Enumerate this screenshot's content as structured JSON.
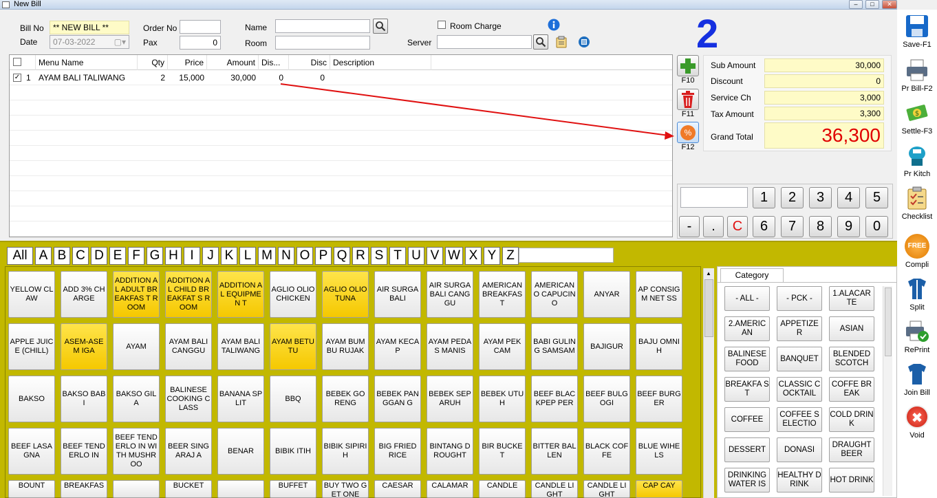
{
  "window": {
    "title": "New Bill",
    "min": "–",
    "max": "□",
    "close": "✕"
  },
  "header": {
    "bill_no_label": "Bill No",
    "bill_no": "** NEW BILL **",
    "date_label": "Date",
    "date": "07-03-2022",
    "order_no_label": "Order No",
    "order_no": "",
    "pax_label": "Pax",
    "pax": "0",
    "name_label": "Name",
    "name": "",
    "room_label": "Room",
    "room": "",
    "room_charge_label": "Room Charge",
    "server_label": "Server",
    "server": ""
  },
  "table_number": "2",
  "grid": {
    "columns": [
      "Menu Name",
      "Qty",
      "Price",
      "Amount",
      "Dis...",
      "Disc",
      "Description"
    ],
    "rows": [
      {
        "checked": true,
        "no": "1",
        "menu": "AYAM BALI TALIWANG",
        "qty": "2",
        "price": "15,000",
        "amount": "30,000",
        "dis": "0",
        "disc": "0",
        "desc": ""
      }
    ]
  },
  "fkeys": {
    "add": "F10",
    "delete": "F11",
    "discount": "F12",
    "discount_symbol": "%"
  },
  "totals": {
    "sub_amount_label": "Sub Amount",
    "sub_amount": "30,000",
    "discount_label": "Discount",
    "discount": "0",
    "service_label": "Service Ch",
    "service": "3,000",
    "tax_label": "Tax Amount",
    "tax": "3,300",
    "grand_label": "Grand Total",
    "grand": "36,300"
  },
  "numpad": {
    "display": "",
    "row1": [
      "1",
      "2",
      "3",
      "4",
      "5"
    ],
    "row2": [
      "-",
      ".",
      "C",
      "6",
      "7",
      "8",
      "9",
      "0"
    ]
  },
  "sidebar": [
    {
      "label": "Save-F1",
      "icon": "floppy-icon"
    },
    {
      "label": "Pr Bill-F2",
      "icon": "printer-icon"
    },
    {
      "label": "Settle-F3",
      "icon": "money-icon"
    },
    {
      "label": "Pr Kitch",
      "icon": "kitchen-printer-icon"
    },
    {
      "label": "Checklist",
      "icon": "checklist-icon"
    },
    {
      "label": "Compli",
      "icon": "free-badge-icon",
      "badge": "FREE"
    },
    {
      "label": "Split",
      "icon": "split-shirt-icon"
    },
    {
      "label": "RePrint",
      "icon": "reprint-icon"
    },
    {
      "label": "Join Bill",
      "icon": "join-shirt-icon"
    },
    {
      "label": "Void",
      "icon": "void-icon",
      "symbol": "✖"
    }
  ],
  "alphabet": [
    "All",
    "A",
    "B",
    "C",
    "D",
    "E",
    "F",
    "G",
    "H",
    "I",
    "J",
    "K",
    "L",
    "M",
    "N",
    "O",
    "P",
    "Q",
    "R",
    "S",
    "T",
    "U",
    "V",
    "W",
    "X",
    "Y",
    "Z"
  ],
  "alpha_search": "",
  "menu_items": [
    {
      "t": "YELLOW CLAW",
      "y": false
    },
    {
      "t": "ADD 3% CHARGE",
      "y": false
    },
    {
      "t": "ADDITION AL ADULT BREAKFAS T ROOM",
      "y": true
    },
    {
      "t": "ADDITION AL CHILD BREAKFAT S ROOM",
      "y": true
    },
    {
      "t": "ADDITION AL EQUIPMEN T",
      "y": true
    },
    {
      "t": "AGLIO OLIO CHICKEN",
      "y": false
    },
    {
      "t": "AGLIO OLIO TUNA",
      "y": true
    },
    {
      "t": "AIR SURGA BALI",
      "y": false
    },
    {
      "t": "AIR SURGA BALI CANGGU",
      "y": false
    },
    {
      "t": "AMERICAN BREAKFAS T",
      "y": false
    },
    {
      "t": "AMERICAN O CAPUCINO",
      "y": false
    },
    {
      "t": "ANYAR",
      "y": false
    },
    {
      "t": "AP CONSIGM NET SS",
      "y": false
    },
    {
      "t": "APPLE JUICE (CHILL)",
      "y": false
    },
    {
      "t": "ASEM-ASE M IGA",
      "y": true
    },
    {
      "t": "AYAM",
      "y": false
    },
    {
      "t": "AYAM BALI CANGGU",
      "y": false
    },
    {
      "t": "AYAM BALI TALIWANG",
      "y": false
    },
    {
      "t": "AYAM BETUTU",
      "y": true
    },
    {
      "t": "AYAM BUMBU RUJAK",
      "y": false
    },
    {
      "t": "AYAM KECAP",
      "y": false
    },
    {
      "t": "AYAM PEDAS MANIS",
      "y": false
    },
    {
      "t": "AYAM PEK CAM",
      "y": false
    },
    {
      "t": "BABI GULING SAMSAM",
      "y": false
    },
    {
      "t": "BAJIGUR",
      "y": false
    },
    {
      "t": "BAJU OMNIH",
      "y": false
    },
    {
      "t": "BAKSO",
      "y": false
    },
    {
      "t": "BAKSO BABI",
      "y": false
    },
    {
      "t": "BAKSO GILA",
      "y": false
    },
    {
      "t": "BALINESE COOKING CLASS",
      "y": false
    },
    {
      "t": "BANANA SPLIT",
      "y": false
    },
    {
      "t": "BBQ",
      "y": false
    },
    {
      "t": "BEBEK GORENG",
      "y": false
    },
    {
      "t": "BEBEK PANGGAN G",
      "y": false
    },
    {
      "t": "BEBEK SEPARUH",
      "y": false
    },
    {
      "t": "BEBEK UTUH",
      "y": false
    },
    {
      "t": "BEEF BLACKPEP PER",
      "y": false
    },
    {
      "t": "BEEF BULGOGI",
      "y": false
    },
    {
      "t": "BEEF BURGER",
      "y": false
    },
    {
      "t": "BEEF LASAGNA",
      "y": false
    },
    {
      "t": "BEEF TENDERLO IN",
      "y": false
    },
    {
      "t": "BEEF TENDERLO IN WITH MUSHROO",
      "y": false
    },
    {
      "t": "BEER SINGARAJ A",
      "y": false
    },
    {
      "t": "BENAR",
      "y": false
    },
    {
      "t": "BIBIK ITIH",
      "y": false
    },
    {
      "t": "BIBIK SIPIRIH",
      "y": false
    },
    {
      "t": "BIG FRIED RICE",
      "y": false
    },
    {
      "t": "BINTANG DROUGHT",
      "y": false
    },
    {
      "t": "BIR BUCKET",
      "y": false
    },
    {
      "t": "BITTER BALLEN",
      "y": false
    },
    {
      "t": "BLACK COFFE",
      "y": false
    },
    {
      "t": "BLUE WIHELS",
      "y": false
    },
    {
      "t": "BOUNT",
      "y": false
    },
    {
      "t": "BREAKFAS",
      "y": false
    },
    {
      "t": "",
      "y": false
    },
    {
      "t": "BUCKET",
      "y": false
    },
    {
      "t": "",
      "y": false
    },
    {
      "t": "BUFFET",
      "y": false
    },
    {
      "t": "BUY TWO GET ONE",
      "y": false
    },
    {
      "t": "CAESAR",
      "y": false
    },
    {
      "t": "CALAMAR",
      "y": false
    },
    {
      "t": "CANDLE",
      "y": false
    },
    {
      "t": "CANDLE LIGHT",
      "y": false
    },
    {
      "t": "CANDLE LIGHT",
      "y": false
    },
    {
      "t": "CAP CAY",
      "y": true
    }
  ],
  "category": {
    "tab": "Category",
    "items": [
      "- ALL -",
      "- PCK -",
      "1.ALACAR TE",
      "2.AMERIC AN",
      "APPETIZE R",
      "ASIAN",
      "BALINESE FOOD",
      "BANQUET",
      "BLENDED SCOTCH",
      "BREAKFA ST",
      "CLASSIC COCKTAIL",
      "COFFE BREAK",
      "COFFEE",
      "COFFEE SELECTIO",
      "COLD DRINK",
      "DESSERT",
      "DONASI",
      "DRAUGHT BEER",
      "DRINKING WATER IS",
      "HEALTHY DRINK",
      "HOT DRINK"
    ]
  },
  "colors": {
    "accent": "#1530e0",
    "grand_total": "#e00000",
    "yellow_bg": "#c2b800",
    "highlight_item": "#f5c800",
    "arrow": "#e01010"
  }
}
